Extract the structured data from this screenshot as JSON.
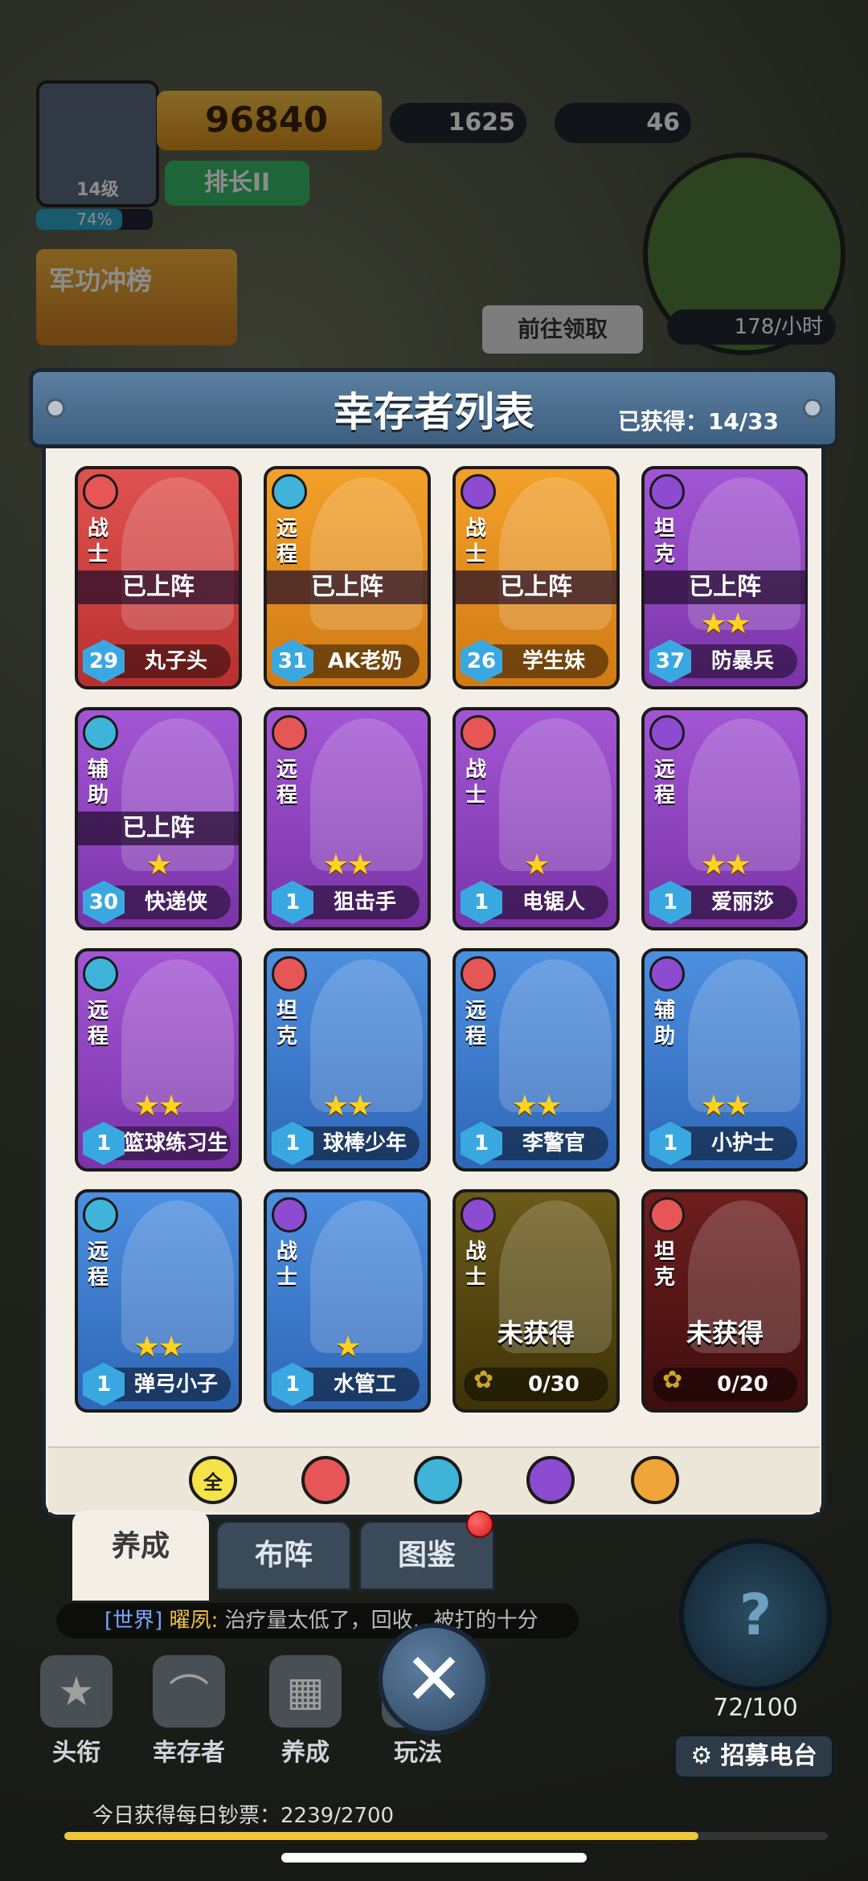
{
  "hud": {
    "player_level": "14级",
    "xp_percent": "74%",
    "xp_fraction": 0.74,
    "power": "96840",
    "rank": "排长II",
    "gems": "1625",
    "meat": "46",
    "honor_event": "军功冲榜",
    "goto_claim": "前往领取",
    "production_rate": "178/小时"
  },
  "panel": {
    "title": "幸存者列表",
    "obtained": "已获得：14/33",
    "deployed_label": "已上阵",
    "not_obtained_label": "未获得"
  },
  "survivors": [
    {
      "class": "战士",
      "class_icon": "fighter-icon",
      "color": "red",
      "name": "丸子头",
      "level": "29",
      "deployed": true,
      "stars": 0
    },
    {
      "class": "远程",
      "class_icon": "ranged-icon",
      "color": "orange",
      "name": "AK老奶",
      "level": "31",
      "deployed": true,
      "stars": 0
    },
    {
      "class": "战士",
      "class_icon": "tank-icon",
      "color": "orange",
      "name": "学生妹",
      "level": "26",
      "deployed": true,
      "stars": 0
    },
    {
      "class": "坦克",
      "class_icon": "tank-icon",
      "color": "purple",
      "name": "防暴兵",
      "level": "37",
      "deployed": true,
      "stars": 2
    },
    {
      "class": "辅助",
      "class_icon": "support-icon",
      "color": "purple",
      "name": "快递侠",
      "level": "30",
      "deployed": true,
      "stars": 1
    },
    {
      "class": "远程",
      "class_icon": "fighter-icon",
      "color": "purple",
      "name": "狙击手",
      "level": "1",
      "deployed": false,
      "stars": 2
    },
    {
      "class": "战士",
      "class_icon": "fighter-icon",
      "color": "purple",
      "name": "电锯人",
      "level": "1",
      "deployed": false,
      "stars": 1
    },
    {
      "class": "远程",
      "class_icon": "tank-icon",
      "color": "purple",
      "name": "爱丽莎",
      "level": "1",
      "deployed": false,
      "stars": 2
    },
    {
      "class": "远程",
      "class_icon": "ranged-icon",
      "color": "purple",
      "name": "篮球练习生",
      "level": "1",
      "deployed": false,
      "stars": 2
    },
    {
      "class": "坦克",
      "class_icon": "fighter-icon",
      "color": "blue",
      "name": "球棒少年",
      "level": "1",
      "deployed": false,
      "stars": 2
    },
    {
      "class": "远程",
      "class_icon": "fighter-icon",
      "color": "blue",
      "name": "李警官",
      "level": "1",
      "deployed": false,
      "stars": 2
    },
    {
      "class": "辅助",
      "class_icon": "tank-icon",
      "color": "blue",
      "name": "小护士",
      "level": "1",
      "deployed": false,
      "stars": 2
    },
    {
      "class": "远程",
      "class_icon": "ranged-icon",
      "color": "blue",
      "name": "弹弓小子",
      "level": "1",
      "deployed": false,
      "stars": 2
    },
    {
      "class": "战士",
      "class_icon": "tank-icon",
      "color": "blue",
      "name": "水管工",
      "level": "1",
      "deployed": false,
      "stars": 1
    },
    {
      "class": "战士",
      "class_icon": "legend-icon",
      "color": "locked-gold",
      "name": "",
      "progress": "0/30",
      "locked": true
    },
    {
      "class": "坦克",
      "class_icon": "fighter-icon",
      "color": "locked-red",
      "name": "",
      "progress": "0/20",
      "locked": true
    }
  ],
  "filters": [
    {
      "label": "全",
      "icon": "all-filter-icon",
      "color": "#f6e34a"
    },
    {
      "label": "",
      "icon": "fighter-filter-icon",
      "color": "#e65656"
    },
    {
      "label": "",
      "icon": "ranged-filter-icon",
      "color": "#3fb4d8"
    },
    {
      "label": "",
      "icon": "tank-filter-icon",
      "color": "#8c4bd0"
    },
    {
      "label": "",
      "icon": "legend-filter-icon",
      "color": "#f0a53a"
    }
  ],
  "tabs": {
    "develop": "养成",
    "formation": "布阵",
    "codex": "图鉴"
  },
  "chat": {
    "channel": "[世界]",
    "user": "曜夙:",
    "message": "治疗量太低了，回收…被打的十分"
  },
  "bottom_nav": {
    "title": "头衔",
    "survivors": "幸存者",
    "develop": "养成",
    "gameplay": "玩法"
  },
  "radar": {
    "count": "72/100",
    "recruit": "招募电台"
  },
  "daily": {
    "text": "今日获得每日钞票：2239/2700",
    "fraction": 0.83
  },
  "colors": {
    "panel_bg": "#f3efe6",
    "header_bg": "#4a6d8e",
    "star": "#ffd21f"
  }
}
